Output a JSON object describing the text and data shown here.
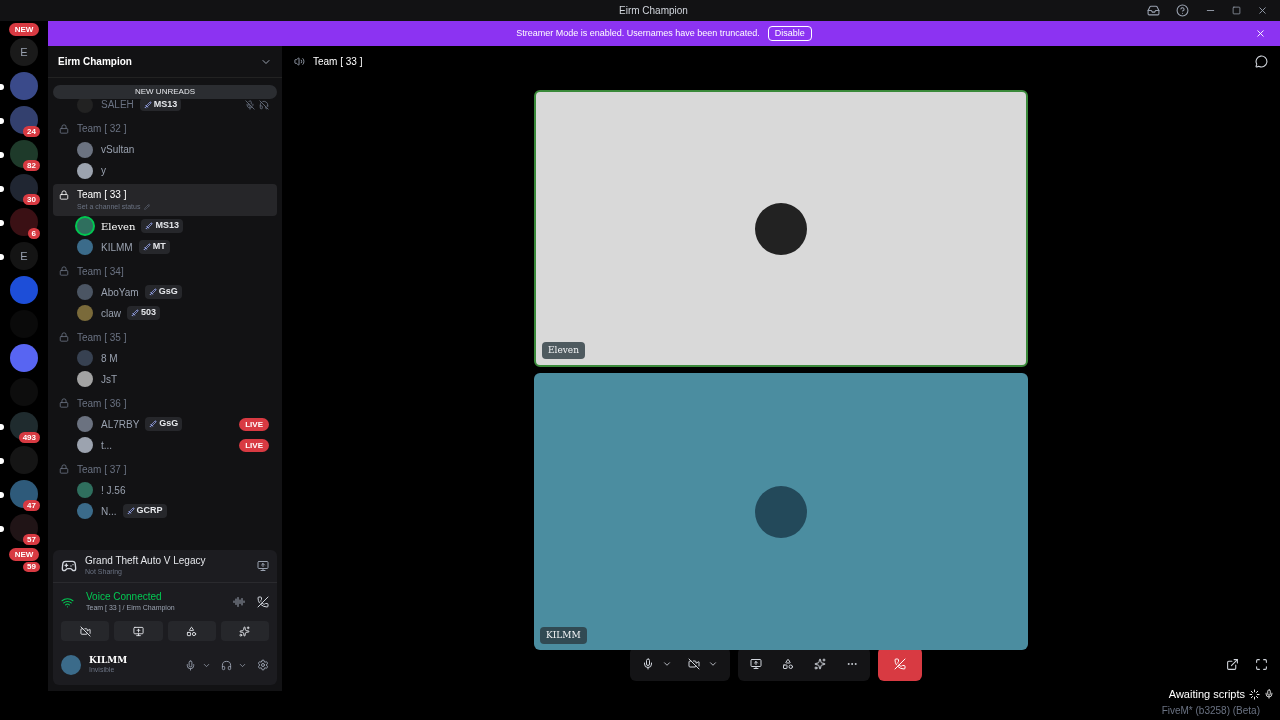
{
  "window": {
    "title": "Eirm Champion"
  },
  "banner": {
    "text": "Streamer Mode is enabled. Usernames have been truncated.",
    "button": "Disable"
  },
  "servers": [
    {
      "label": "E",
      "unread": false,
      "color": "#1a1a1a"
    },
    {
      "unread": true,
      "color": "#3a4a8a"
    },
    {
      "badge": "24",
      "unread": true,
      "color": "#33406e"
    },
    {
      "badge": "82",
      "unread": true,
      "color": "#1e3a2a"
    },
    {
      "badge": "30",
      "unread": true,
      "color": "#202632"
    },
    {
      "badge": "6",
      "unread": true,
      "color": "#3a1014"
    },
    {
      "label": "E",
      "unread": true,
      "color": "#141414"
    },
    {
      "unread": false,
      "color": "#1d4ed8"
    },
    {
      "unread": false,
      "color": "#0a0a0a"
    },
    {
      "unread": false,
      "color": "#5865f2"
    },
    {
      "unread": false,
      "color": "#0d0d0d"
    },
    {
      "badge": "493",
      "unread": true,
      "color": "#1f2b2e"
    },
    {
      "unread": true,
      "color": "#151515"
    },
    {
      "badge": "47",
      "unread": true,
      "color": "#2e5a7a"
    },
    {
      "badge": "57",
      "unread": true,
      "color": "#201416"
    }
  ],
  "new_pills": [
    "NEW",
    "NEW"
  ],
  "last_badge": "59",
  "guild": {
    "name": "Eirm Champion"
  },
  "new_unreads": "NEW UNREADS",
  "orphan_member": {
    "name": "SALEH",
    "tag": "MS13"
  },
  "channels": [
    {
      "name": "Team [ 32 ]",
      "selected": false,
      "members": [
        {
          "name": "vSultan",
          "speaking": false
        },
        {
          "name": "y",
          "speaking": false
        }
      ]
    },
    {
      "name": "Team [ 33 ]",
      "selected": true,
      "status": "Set a channel status",
      "members": [
        {
          "name": "Eleven",
          "tag": "MS13",
          "speaking": true
        },
        {
          "name": "KILMM",
          "tag": "MT",
          "speaking": false
        }
      ]
    },
    {
      "name": "Team [ 34]",
      "selected": false,
      "members": [
        {
          "name": "AboYam",
          "tag": "GsG",
          "speaking": false
        },
        {
          "name": "claw",
          "tag": "503",
          "speaking": false
        }
      ]
    },
    {
      "name": "Team [ 35 ]",
      "selected": false,
      "members": [
        {
          "name": "8 M",
          "speaking": false
        },
        {
          "name": "JsT",
          "speaking": false
        }
      ]
    },
    {
      "name": "Team [ 36 ]",
      "selected": false,
      "members": [
        {
          "name": "AL7RBY",
          "tag": "GsG",
          "speaking": false,
          "live_label": "LIVE"
        },
        {
          "name": "t...",
          "speaking": false,
          "live_label": "LIVE"
        }
      ]
    },
    {
      "name": "Team [ 37 ]",
      "selected": false,
      "members": [
        {
          "name": "! J.56",
          "speaking": false
        },
        {
          "name": "N...",
          "tag": "GCRP",
          "speaking": false
        }
      ]
    }
  ],
  "activity": {
    "title": "Grand Theft Auto V Legacy",
    "subtitle": "Not Sharing"
  },
  "voice": {
    "status": "Voice Connected",
    "channel": "Team [ 33 ] / Eirm Champion"
  },
  "user": {
    "name": "KILMM",
    "status": "Invisible"
  },
  "call": {
    "channel": "Team [ 33 ]"
  },
  "tiles": [
    {
      "name": "Eleven",
      "speaking": true,
      "color": "#d9d9d9"
    },
    {
      "name": "KILMM",
      "speaking": false,
      "color": "#4b8da0"
    }
  ],
  "overlay": {
    "status": "Awaiting scripts",
    "version": "FiveM* (b3258) (Beta)"
  }
}
